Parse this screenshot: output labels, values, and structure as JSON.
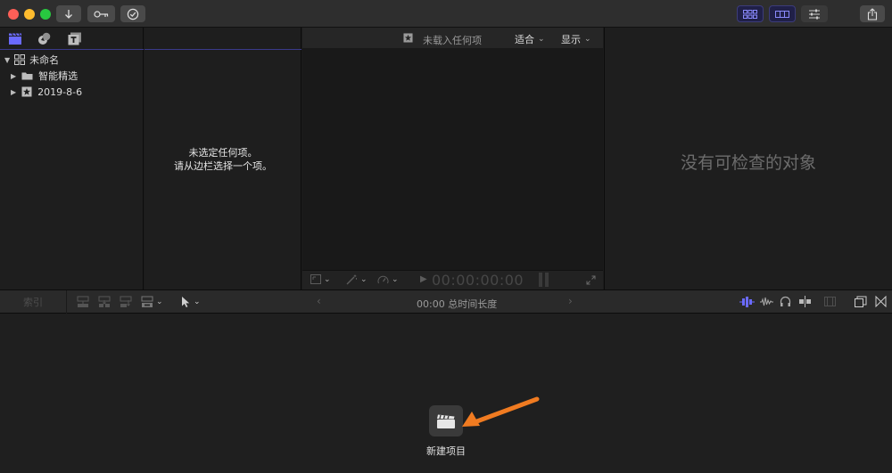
{
  "titlebar": {
    "traffic": {
      "close": "#fe5f57",
      "minimize": "#febc2e",
      "zoom": "#28c840"
    },
    "left_buttons": [
      {
        "icon": "import-arrow-icon"
      },
      {
        "icon": "keyword-key-icon"
      },
      {
        "icon": "checkmark-circle-icon"
      }
    ],
    "right_buttons": [
      {
        "icon": "library-layout-icon",
        "accent": "#5a5aff"
      },
      {
        "icon": "timeline-layout-icon",
        "accent": "#5a5aff"
      },
      {
        "icon": "inspector-sliders-icon"
      },
      {
        "icon": "share-icon"
      }
    ]
  },
  "sidebar": {
    "tabs": [
      {
        "icon": "libraries-clapper-icon",
        "active": true,
        "accent": "#5a5aff"
      },
      {
        "icon": "photos-audio-icon",
        "active": false
      },
      {
        "icon": "titles-generators-icon",
        "active": false
      }
    ],
    "library": {
      "name": "未命名"
    },
    "items": [
      {
        "label": "智能精选",
        "icon": "folder-icon"
      },
      {
        "label": "2019-8-6",
        "icon": "event-star-icon"
      }
    ]
  },
  "browser": {
    "empty_line1": "未选定任何项。",
    "empty_line2": "请从边栏选择一个项。"
  },
  "viewer": {
    "title": "未载入任何项",
    "fit_label": "适合",
    "display_label": "显示",
    "timecode": "00:00:00:00"
  },
  "inspector": {
    "empty_text": "没有可检查的对象"
  },
  "timeline_toolbar": {
    "index_label": "索引",
    "duration_text": "00:00 总时间长度",
    "accent": "#6a6aff"
  },
  "timeline": {
    "new_project_label": "新建项目",
    "arrow_color": "#f07b21"
  }
}
